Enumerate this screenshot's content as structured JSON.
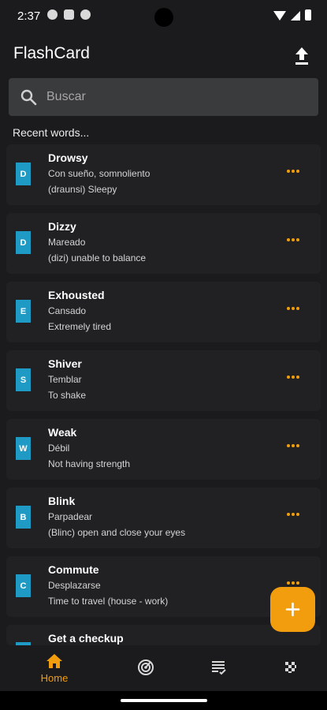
{
  "status_bar": {
    "time": "2:37"
  },
  "header": {
    "title": "FlashCard",
    "upload_icon": "upload-icon"
  },
  "search": {
    "placeholder": "Buscar"
  },
  "recent_heading": "Recent words...",
  "cards": [
    {
      "letter": "D",
      "word": "Drowsy",
      "translation": "Con sueño, somnoliento",
      "note": "(draunsi)  Sleepy"
    },
    {
      "letter": "D",
      "word": "Dizzy",
      "translation": "Mareado",
      "note": "(dizi) unable to balance"
    },
    {
      "letter": "E",
      "word": "Exhousted",
      "translation": "Cansado",
      "note": "Extremely tired"
    },
    {
      "letter": "S",
      "word": "Shiver",
      "translation": "Temblar",
      "note": "To shake"
    },
    {
      "letter": "W",
      "word": "Weak",
      "translation": "Débil",
      "note": "Not having strength"
    },
    {
      "letter": "B",
      "word": "Blink",
      "translation": "Parpadear",
      "note": "(Blinc) open and close your eyes"
    },
    {
      "letter": "C",
      "word": "Commute",
      "translation": "Desplazarse",
      "note": "Time to travel (house - work)"
    },
    {
      "letter": "",
      "word": "Get a checkup",
      "translation": "",
      "note": ""
    }
  ],
  "bottom_nav": {
    "home_label": "Home",
    "items": [
      "home-icon",
      "radar-icon",
      "list-check-icon",
      "grid-icon"
    ]
  },
  "colors": {
    "accent": "#f29d0d",
    "badge": "#1f9ac4",
    "background": "#1b1b1d",
    "card": "#212124"
  }
}
